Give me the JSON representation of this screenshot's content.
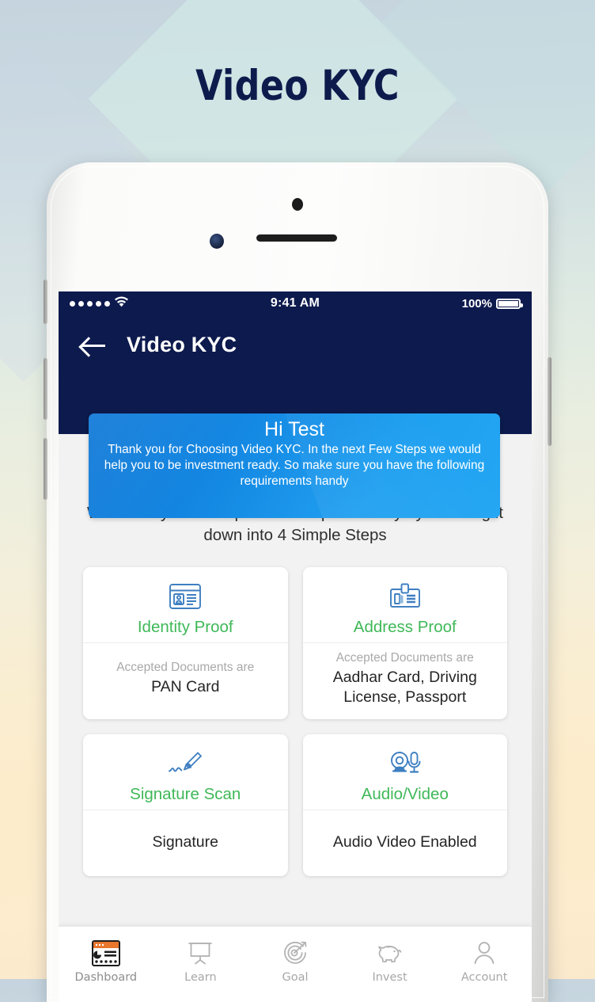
{
  "page": {
    "title": "Video KYC"
  },
  "phone": {
    "statusbar": {
      "time": "9:41 AM",
      "battery": "100%",
      "signal_dots": 5,
      "wifi_icon": "wifi-icon",
      "battery_icon": "battery-full-icon"
    },
    "appbar": {
      "title": "Video KYC",
      "back_icon": "back-arrow-icon"
    },
    "banner": {
      "greeting": "Hi Test",
      "message": "Thank you for Choosing Video KYC. In the next Few Steps we would help you to be investment ready. So make sure you have the following requirements handy"
    },
    "intro": "We made your KYC process simpler & easy by breaking it down into 4 Simple Steps",
    "cards": [
      {
        "icon": "id-card-icon",
        "title": "Identity Proof",
        "sub": "Accepted Documents are",
        "value": "PAN Card"
      },
      {
        "icon": "address-card-icon",
        "title": "Address Proof",
        "sub": "Accepted Documents are",
        "value": "Aadhar Card, Driving License, Passport"
      },
      {
        "icon": "signature-pen-icon",
        "title": "Signature Scan",
        "sub": "",
        "value": "Signature"
      },
      {
        "icon": "webcam-mic-icon",
        "title": "Audio/Video",
        "sub": "",
        "value": "Audio Video Enabled"
      }
    ],
    "tabs": [
      {
        "label": "Dashboard",
        "icon": "dashboard-icon",
        "active": true
      },
      {
        "label": "Learn",
        "icon": "presentation-board-icon",
        "active": false
      },
      {
        "label": "Goal",
        "icon": "target-dart-icon",
        "active": false
      },
      {
        "label": "Invest",
        "icon": "piggy-bank-icon",
        "active": false
      },
      {
        "label": "Account",
        "icon": "person-icon",
        "active": false
      }
    ]
  },
  "colors": {
    "navy": "#0d1a4d",
    "banner_blue": "#1a8ee8",
    "green": "#3fb858",
    "icon_blue": "#3f7fc1",
    "accent_orange": "#e8762c"
  }
}
